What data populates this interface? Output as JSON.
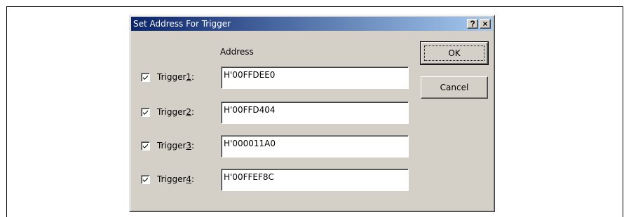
{
  "dialog": {
    "title": "Set Address For Trigger",
    "help_symbol": "?",
    "close_symbol": "×",
    "address_header": "Address",
    "ok_label": "OK",
    "cancel_label": "Cancel"
  },
  "triggers": [
    {
      "label_prefix": "Trigger",
      "accel": "1",
      "label_suffix": ":",
      "checked": true,
      "address": "H'00FFDEE0"
    },
    {
      "label_prefix": "Trigger",
      "accel": "2",
      "label_suffix": ":",
      "checked": true,
      "address": "H'00FFD404"
    },
    {
      "label_prefix": "Trigger",
      "accel": "3",
      "label_suffix": ":",
      "checked": true,
      "address": "H'000011A0"
    },
    {
      "label_prefix": "Trigger",
      "accel": "4",
      "label_suffix": ":",
      "checked": true,
      "address": "H'00FFEF8C"
    }
  ],
  "colors": {
    "titlebar_start": "#0a246a",
    "titlebar_end": "#a6caf0",
    "face": "#d4d0c8"
  }
}
